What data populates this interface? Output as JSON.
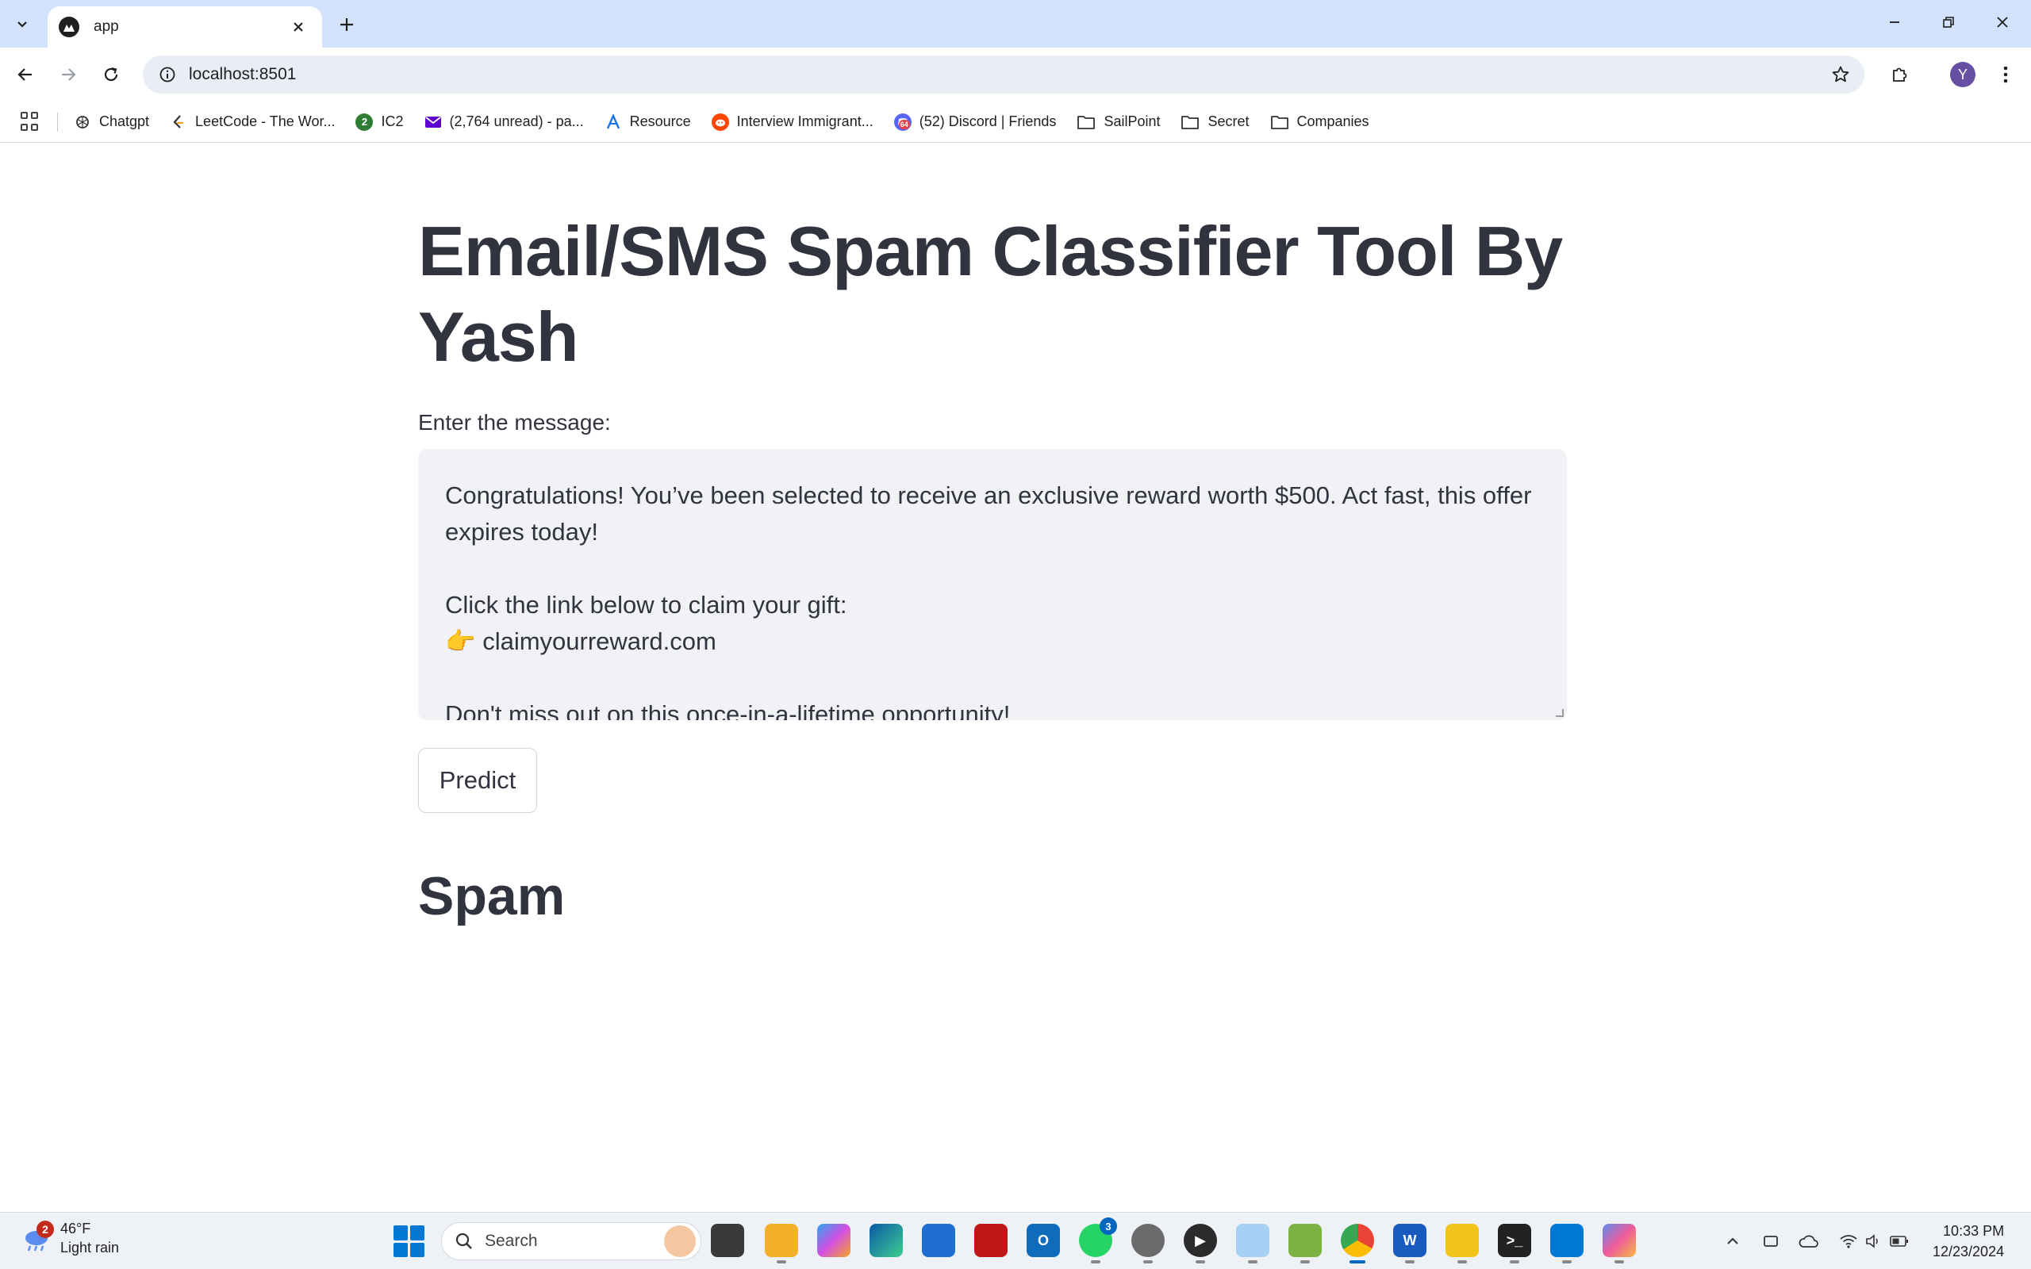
{
  "browser": {
    "tab_title": "app",
    "url": "localhost:8501",
    "profile_initial": "Y"
  },
  "bookmarks": [
    {
      "label": "Chatgpt",
      "icon": "openai-icon"
    },
    {
      "label": "LeetCode - The Wor...",
      "icon": "leetcode-icon"
    },
    {
      "label": "IC2",
      "icon": "ic2-icon",
      "badge": "2"
    },
    {
      "label": "(2,764 unread) - pa...",
      "icon": "mail-icon"
    },
    {
      "label": "Resource",
      "icon": "resource-icon"
    },
    {
      "label": "Interview Immigrant...",
      "icon": "reddit-icon"
    },
    {
      "label": "(52) Discord | Friends",
      "icon": "discord-icon",
      "badge": "64"
    },
    {
      "label": "SailPoint",
      "icon": "folder-icon"
    },
    {
      "label": "Secret",
      "icon": "folder-icon"
    },
    {
      "label": "Companies",
      "icon": "folder-icon"
    }
  ],
  "app": {
    "title": "Email/SMS Spam Classifier Tool By Yash",
    "input_label": "Enter the message:",
    "message": "Congratulations! You’ve been selected to receive an exclusive reward worth $500. Act fast, this offer expires today!\n\nClick the link below to claim your gift:\n👉 claimyourreward.com\n\nDon't miss out on this once-in-a-lifetime opportunity!",
    "predict_label": "Predict",
    "result": "Spam"
  },
  "taskbar": {
    "weather_badge": "2",
    "temperature": "46°F",
    "condition": "Light rain",
    "search_placeholder": "Search",
    "whatsapp_badge": "3",
    "time": "10:33 PM",
    "date": "12/23/2024"
  },
  "colors": {
    "text": "#31333f",
    "textarea_bg": "#f0f2f6",
    "tabstrip": "#d3e3fd",
    "accent": "#0067c0"
  }
}
